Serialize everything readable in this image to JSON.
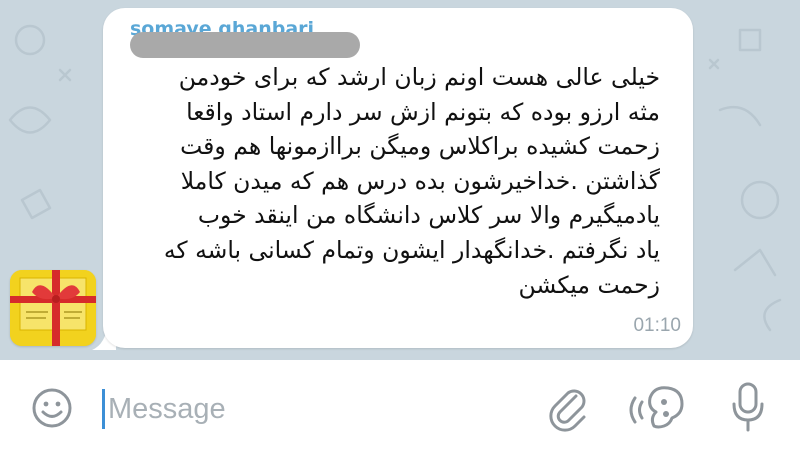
{
  "chat": {
    "message": {
      "sender_name": "somaye ghanbari",
      "text": "خیلی عالی هست اونم زبان ارشد که برای خودمن\nمثه ارزو بوده که بتونم ازش سر دارم استاد واقعا\nزحمت کشیده براکلاس ومیگن براازمونها هم وقت\nگذاشتن .خداخیرشون بده درس هم که میدن کاملا\nیادمیگیرم والا سر کلاس دانشگاه من اینقد خوب\nیاد نگرفتم .خدانگهدار ایشون وتمام کسانی باشه که\nزحمت میکشن",
      "time": "01:10"
    }
  },
  "input_bar": {
    "placeholder": "Message",
    "value": ""
  },
  "colors": {
    "chat_background": "#c9d6de",
    "bubble": "#ffffff",
    "sender_name": "#5aa7d6",
    "caret": "#3c8fd6",
    "icon": "#8e959b"
  },
  "icons": {
    "emoji": "smiley-face-icon",
    "attach": "paperclip-icon",
    "voice_effect": "voice-changer-icon",
    "mic": "microphone-icon"
  }
}
